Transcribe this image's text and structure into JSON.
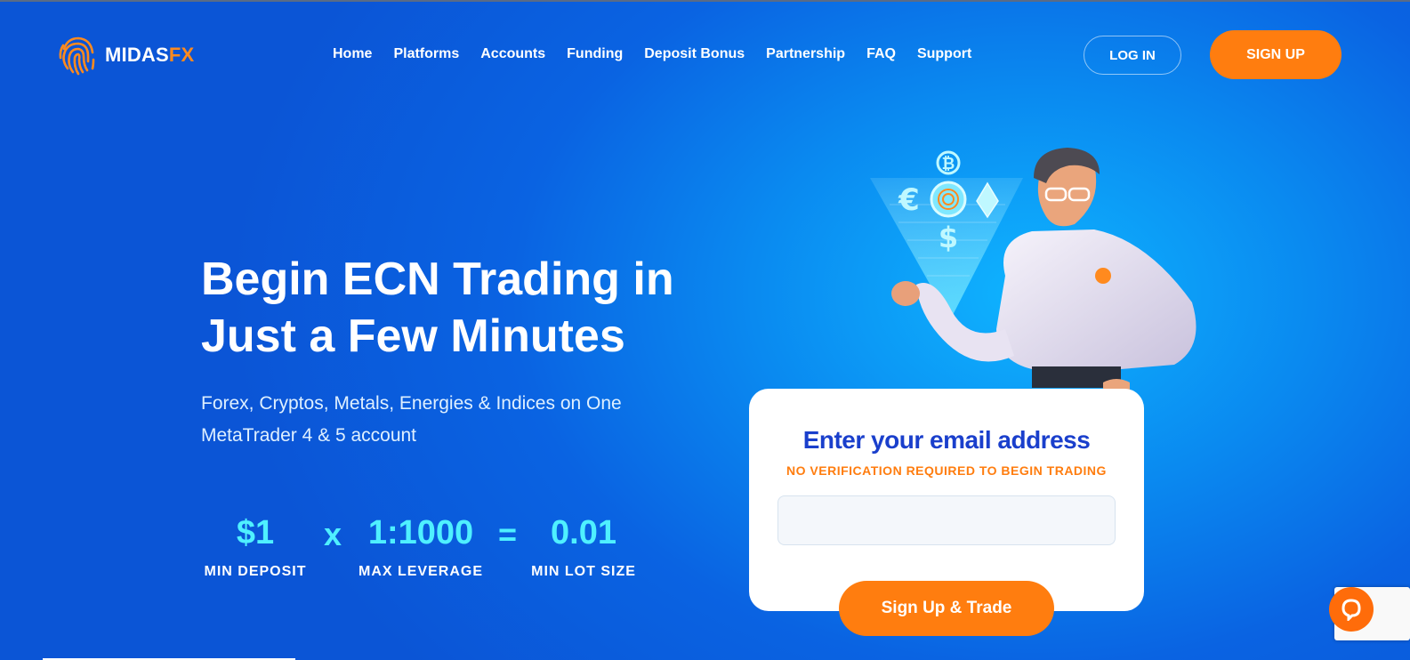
{
  "brand": {
    "name_part1": "MIDAS",
    "name_part2": "FX",
    "accent": "#ff7d0f",
    "logo_icon": "fingerprint-icon"
  },
  "nav": {
    "items": [
      {
        "label": "Home"
      },
      {
        "label": "Platforms"
      },
      {
        "label": "Accounts"
      },
      {
        "label": "Funding"
      },
      {
        "label": "Deposit Bonus"
      },
      {
        "label": "Partnership"
      },
      {
        "label": "FAQ"
      },
      {
        "label": "Support"
      }
    ],
    "login_label": "LOG IN",
    "signup_label": "SIGN UP"
  },
  "hero": {
    "headline_line1": "Begin ECN Trading in",
    "headline_line2": "Just a Few Minutes",
    "subtitle_line1": "Forex, Cryptos, Metals, Energies & Indices on One",
    "subtitle_line2": "MetaTrader 4 & 5 account"
  },
  "stats": {
    "items": [
      {
        "value": "$1",
        "label": "MIN DEPOSIT"
      },
      {
        "value": "1:1000",
        "label": "MAX LEVERAGE"
      },
      {
        "value": "0.01",
        "label": "MIN LOT SIZE"
      }
    ],
    "op1": "x",
    "op2": "=",
    "value_color": "#4ff0ff"
  },
  "illustration": {
    "icons": [
      "bitcoin-icon",
      "euro-icon",
      "ethereum-icon",
      "dollar-icon",
      "fingerprint-icon"
    ],
    "symbols": {
      "euro": "€",
      "dollar": "$",
      "bitcoin": "₿"
    }
  },
  "signup_card": {
    "title": "Enter your email address",
    "note": "NO VERIFICATION REQUIRED TO BEGIN TRADING",
    "email_value": "",
    "email_placeholder": "",
    "button_label": "Sign Up & Trade"
  },
  "widgets": {
    "chat_icon": "chat-bubble-icon"
  }
}
